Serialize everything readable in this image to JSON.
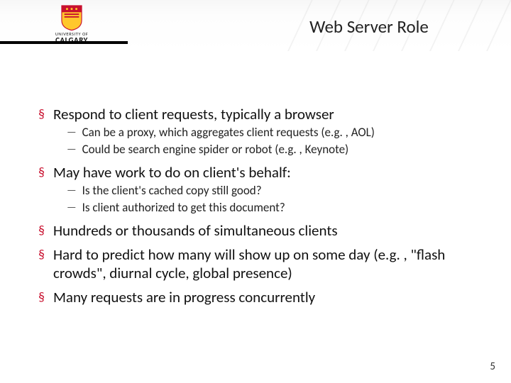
{
  "logo": {
    "university_label": "UNIVERSITY OF",
    "name": "CALGARY"
  },
  "slide": {
    "title": "Web Server Role",
    "page_number": "5"
  },
  "bullets": [
    {
      "text": "Respond to client requests, typically a browser",
      "sub": [
        "Can be a proxy, which aggregates client requests (e.g. , AOL)",
        "Could be search engine spider or robot (e.g. , Keynote)"
      ]
    },
    {
      "text": "May have work to do on client's behalf:",
      "sub": [
        "Is the client's cached copy still good?",
        "Is client authorized to get this document?"
      ]
    },
    {
      "text": "Hundreds or thousands of simultaneous clients",
      "sub": []
    },
    {
      "text": "Hard to predict how many will show up on some day (e.g. , \"flash crowds\", diurnal cycle, global presence)",
      "sub": []
    },
    {
      "text": "Many requests are in progress concurrently",
      "sub": []
    }
  ],
  "marks": {
    "level1": "§",
    "level2": "—"
  }
}
